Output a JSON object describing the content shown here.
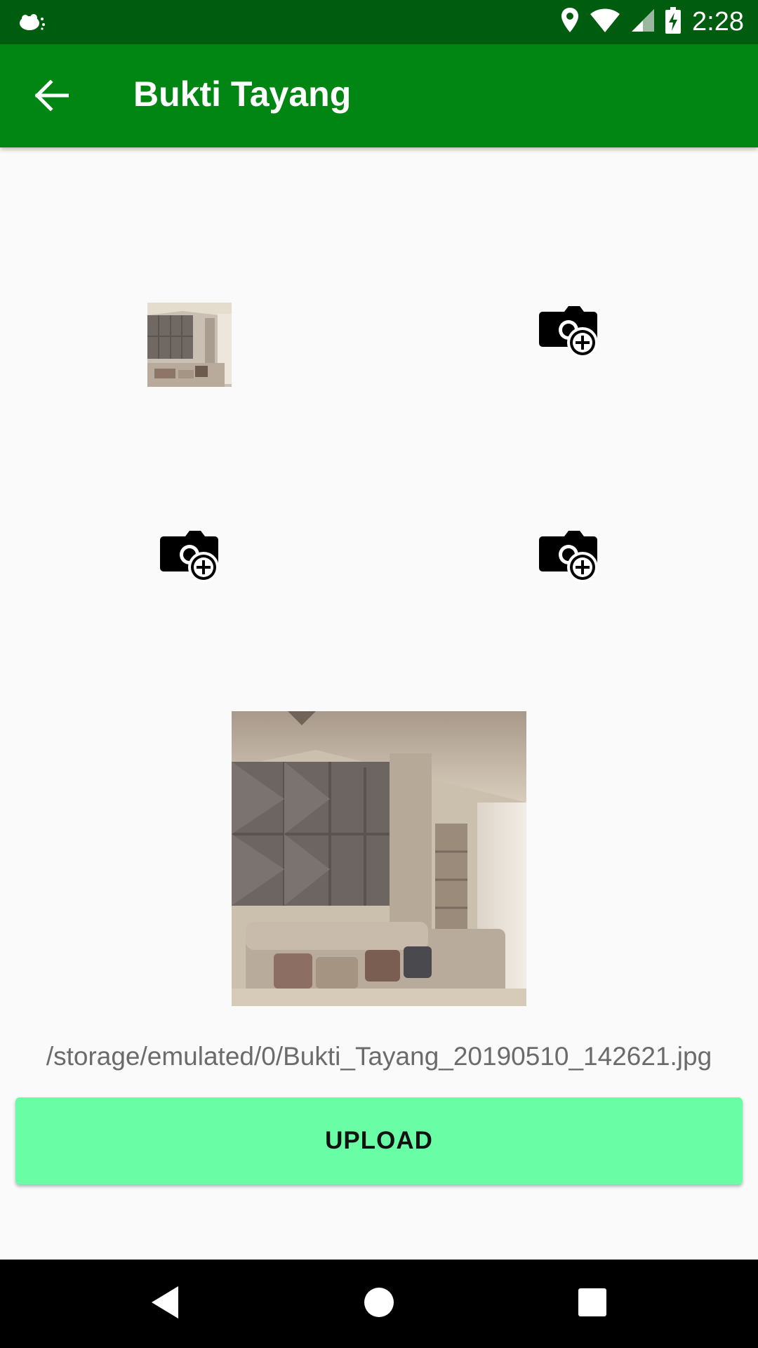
{
  "status_bar": {
    "time": "2:28",
    "icons": [
      "notification-icon",
      "location-icon",
      "wifi-icon",
      "signal-icon",
      "battery-charging-icon"
    ]
  },
  "app_bar": {
    "title": "Bukti Tayang",
    "back_icon": "arrow-back-icon"
  },
  "photo_slots": [
    {
      "state": "filled",
      "icon": "photo-thumbnail"
    },
    {
      "state": "empty",
      "icon": "add-camera-icon"
    },
    {
      "state": "empty",
      "icon": "add-camera-icon"
    },
    {
      "state": "empty",
      "icon": "add-camera-icon"
    }
  ],
  "preview": {
    "icon": "photo-preview"
  },
  "file_path": "/storage/emulated/0/Bukti_Tayang_20190510_142621.jpg",
  "upload_button": {
    "label": "UPLOAD",
    "color": "#69fea5"
  },
  "nav_bar": {
    "icons": [
      "back-triangle-icon",
      "home-circle-icon",
      "recents-square-icon"
    ]
  },
  "colors": {
    "status_bar": "#005c0e",
    "app_bar": "#018613",
    "background": "#fafafa"
  }
}
